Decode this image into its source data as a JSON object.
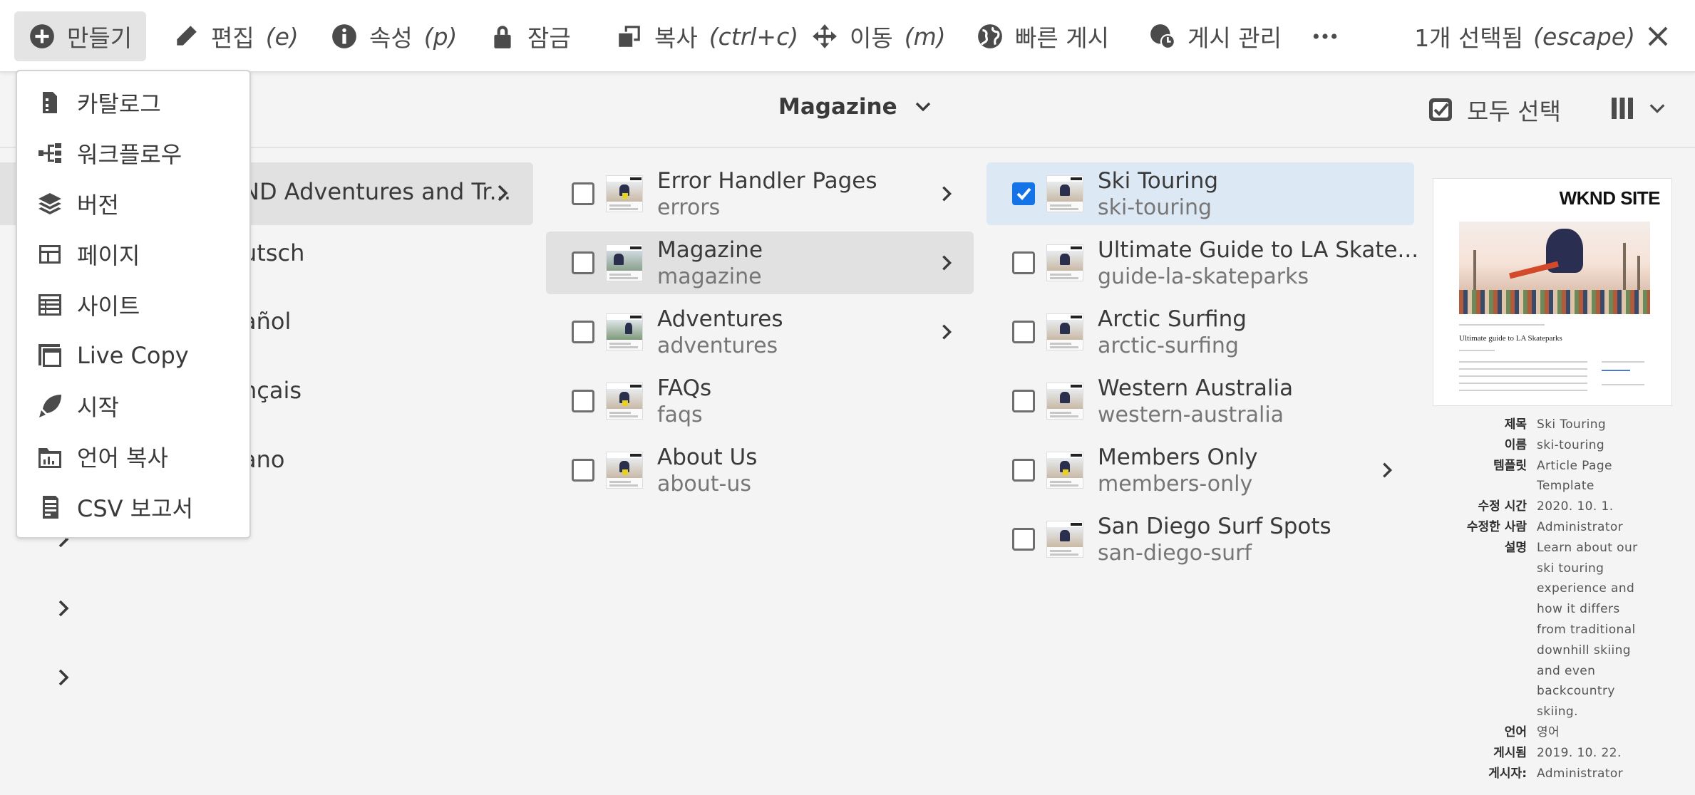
{
  "actionbar": {
    "create": {
      "label": "만들기",
      "icon": "add-circle-icon"
    },
    "edit": {
      "label": "편집",
      "shortcut": "(e)",
      "icon": "pencil-icon"
    },
    "properties": {
      "label": "속성",
      "shortcut": "(p)",
      "icon": "info-icon"
    },
    "lock": {
      "label": "잠금",
      "icon": "lock-icon"
    },
    "copy": {
      "label": "복사",
      "shortcut": "(ctrl+c)",
      "icon": "copy-icon"
    },
    "move": {
      "label": "이동",
      "shortcut": "(m)",
      "icon": "move-icon"
    },
    "quick_publish": {
      "label": "빠른 게시",
      "icon": "globe-icon"
    },
    "manage_publication": {
      "label": "게시 관리",
      "icon": "globe-clock-icon"
    },
    "more": {
      "icon": "more-icon"
    },
    "selection": {
      "label": "1개 선택됨",
      "escape_hint": "(escape)",
      "icon": "close-icon"
    }
  },
  "subheader": {
    "breadcrumb": "Magazine",
    "select_all": "모두 선택",
    "view_switcher_icon": "column-view-icon"
  },
  "create_menu": {
    "items": [
      {
        "label": "카탈로그",
        "icon": "catalog-icon"
      },
      {
        "label": "워크플로우",
        "icon": "workflow-icon"
      },
      {
        "label": "버전",
        "icon": "layers-icon"
      },
      {
        "label": "페이지",
        "icon": "page-icon"
      },
      {
        "label": "사이트",
        "icon": "site-icon"
      },
      {
        "label": "Live Copy",
        "icon": "live-copy-icon"
      },
      {
        "label": "시작",
        "icon": "launch-icon"
      },
      {
        "label": "언어 복사",
        "icon": "language-copy-icon"
      },
      {
        "label": "CSV 보고서",
        "icon": "csv-report-icon"
      }
    ]
  },
  "column0": {
    "items": [
      {
        "label": "ND Adventures and Tr..."
      },
      {
        "label": "utsch"
      },
      {
        "label": "añol"
      },
      {
        "label": "nçais"
      },
      {
        "label": "ano"
      }
    ]
  },
  "column1": {
    "items": [
      {
        "title": "Error Handler Pages",
        "name": "errors"
      },
      {
        "title": "Magazine",
        "name": "magazine"
      },
      {
        "title": "Adventures",
        "name": "adventures"
      },
      {
        "title": "FAQs",
        "name": "faqs"
      },
      {
        "title": "About Us",
        "name": "about-us"
      }
    ]
  },
  "column2": {
    "items": [
      {
        "title": "Ski Touring",
        "name": "ski-touring"
      },
      {
        "title": "Ultimate Guide to LA Skate...",
        "name": "guide-la-skateparks"
      },
      {
        "title": "Arctic Surfing",
        "name": "arctic-surfing"
      },
      {
        "title": "Western Australia",
        "name": "western-australia"
      },
      {
        "title": "Members Only",
        "name": "members-only"
      },
      {
        "title": "San Diego Surf Spots",
        "name": "san-diego-surf"
      }
    ]
  },
  "preview": {
    "brand": "WKND SITE",
    "article_title": "Ultimate guide to LA Skateparks"
  },
  "metadata": {
    "title_label": "제목",
    "title_value": "Ski Touring",
    "name_label": "이름",
    "name_value": "ski-touring",
    "template_label": "템플릿",
    "template_value_1": "Article Page",
    "template_value_2": "Template",
    "modified_label": "수정 시간",
    "modified_value": "2020. 10. 1.",
    "modified_by_label": "수정한 사람",
    "modified_by_value": "Administrator",
    "description_label": "설명",
    "description_lines": [
      "Learn about our",
      "ski touring",
      "experience and",
      "how it differs",
      "from traditional",
      "downhill skiing",
      "and even",
      "backcountry",
      "skiing."
    ],
    "language_label": "언어",
    "language_value": "영어",
    "published_label": "게시됨",
    "published_value": "2019. 10. 22.",
    "published_by_label": "게시자:",
    "published_by_value": "Administrator"
  },
  "colors": {
    "accent": "#1473e6",
    "selected_row": "#dde8f5",
    "active_row": "#e1e1e1"
  }
}
